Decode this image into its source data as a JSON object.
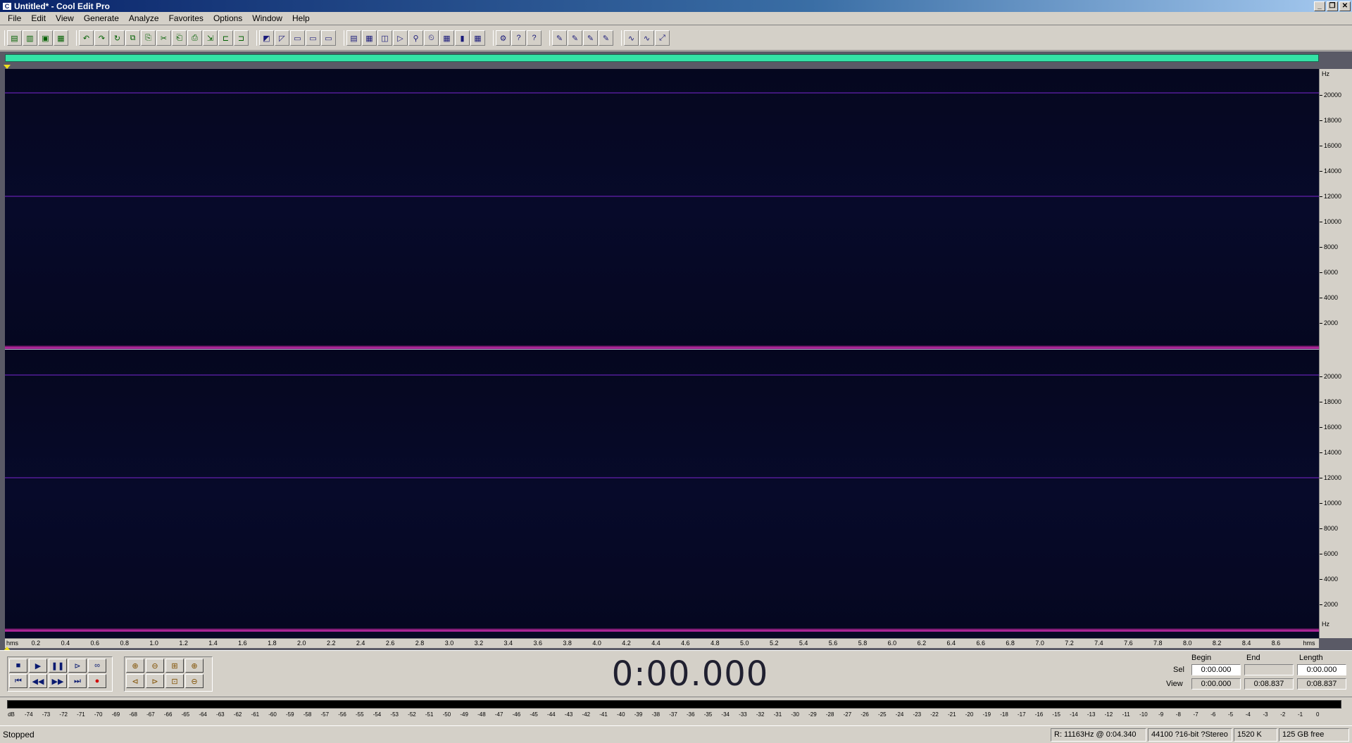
{
  "window": {
    "title": "Untitled* - Cool Edit Pro",
    "buttons": [
      "_",
      "❐",
      "✕"
    ]
  },
  "menu": [
    "File",
    "Edit",
    "View",
    "Generate",
    "Analyze",
    "Favorites",
    "Options",
    "Window",
    "Help"
  ],
  "toolbar": {
    "groups": [
      [
        "waveform-view-icon",
        "multitrack-view-icon",
        "open-icon",
        "save-icon"
      ],
      [
        "undo-icon",
        "redo-icon",
        "repeat-icon",
        "copy-icon",
        "copy-new-icon",
        "cut-icon",
        "paste-icon",
        "paste-new-icon",
        "mix-paste-icon",
        "trim-icon",
        "select-entire-icon"
      ],
      [
        "spectral-view-icon",
        "waveform-icon",
        "left-channel-icon",
        "right-channel-icon",
        "both-channels-icon"
      ],
      [
        "cue-list-icon",
        "play-list-icon",
        "info-icon",
        "preroll-icon",
        "scrub-icon",
        "time-format-icon",
        "frames-icon",
        "meter-icon",
        "grid-icon"
      ],
      [
        "settings-icon",
        "hint-icon",
        "help-icon"
      ],
      [
        "effect-1-icon",
        "effect-2-icon",
        "effect-3-icon",
        "effect-4-icon"
      ],
      [
        "analysis-icon",
        "stats-icon",
        "zoom-full-icon"
      ]
    ]
  },
  "spectrogram": {
    "hz_unit": "Hz",
    "hz_labels": [
      "20000",
      "18000",
      "16000",
      "14000",
      "12000",
      "10000",
      "8000",
      "6000",
      "4000",
      "2000"
    ],
    "time_labels": [
      "hms",
      "0.2",
      "0.4",
      "0.6",
      "0.8",
      "1.0",
      "1.2",
      "1.4",
      "1.6",
      "1.8",
      "2.0",
      "2.2",
      "2.4",
      "2.6",
      "2.8",
      "3.0",
      "3.2",
      "3.4",
      "3.6",
      "3.8",
      "4.0",
      "4.2",
      "4.4",
      "4.6",
      "4.8",
      "5.0",
      "5.2",
      "5.4",
      "5.6",
      "5.8",
      "6.0",
      "6.2",
      "6.4",
      "6.6",
      "6.8",
      "7.0",
      "7.2",
      "7.4",
      "7.6",
      "7.8",
      "8.0",
      "8.2",
      "8.4",
      "8.6",
      "hms"
    ],
    "duration_seconds": 8.837
  },
  "transport": {
    "time_display": "0:00.000",
    "row1": [
      {
        "name": "stop-icon",
        "glyph": "■"
      },
      {
        "name": "play-icon",
        "glyph": "▶"
      },
      {
        "name": "pause-icon",
        "glyph": "❚❚"
      },
      {
        "name": "play-to-end-icon",
        "glyph": "⊳"
      },
      {
        "name": "loop-icon",
        "glyph": "∞"
      }
    ],
    "row2": [
      {
        "name": "go-to-start-icon",
        "glyph": "⏮"
      },
      {
        "name": "rewind-icon",
        "glyph": "◀◀"
      },
      {
        "name": "fast-forward-icon",
        "glyph": "▶▶"
      },
      {
        "name": "go-to-end-icon",
        "glyph": "⏭"
      },
      {
        "name": "record-icon",
        "glyph": "●"
      }
    ],
    "zoom_row1": [
      {
        "name": "zoom-in-icon",
        "glyph": "⊕"
      },
      {
        "name": "zoom-out-icon",
        "glyph": "⊖"
      },
      {
        "name": "zoom-full-icon",
        "glyph": "⊞"
      },
      {
        "name": "zoom-in-vertical-icon",
        "glyph": "⊕"
      }
    ],
    "zoom_row2": [
      {
        "name": "zoom-left-icon",
        "glyph": "⊲"
      },
      {
        "name": "zoom-right-icon",
        "glyph": "⊳"
      },
      {
        "name": "zoom-selection-icon",
        "glyph": "⊡"
      },
      {
        "name": "zoom-out-vertical-icon",
        "glyph": "⊖"
      }
    ]
  },
  "selection": {
    "begin_label": "Begin",
    "end_label": "End",
    "length_label": "Length",
    "sel_label": "Sel",
    "view_label": "View",
    "sel_begin": "0:00.000",
    "sel_end": "",
    "sel_length": "0:00.000",
    "view_begin": "0:00.000",
    "view_end": "0:08.837",
    "view_length": "0:08.837"
  },
  "meter": {
    "labels": [
      "dB",
      "-74",
      "-73",
      "-72",
      "-71",
      "-70",
      "-69",
      "-68",
      "-67",
      "-66",
      "-65",
      "-64",
      "-63",
      "-62",
      "-61",
      "-60",
      "-59",
      "-58",
      "-57",
      "-56",
      "-55",
      "-54",
      "-53",
      "-52",
      "-51",
      "-50",
      "-49",
      "-48",
      "-47",
      "-46",
      "-45",
      "-44",
      "-43",
      "-42",
      "-41",
      "-40",
      "-39",
      "-38",
      "-37",
      "-36",
      "-35",
      "-34",
      "-33",
      "-32",
      "-31",
      "-30",
      "-29",
      "-28",
      "-27",
      "-26",
      "-25",
      "-24",
      "-23",
      "-22",
      "-21",
      "-20",
      "-19",
      "-18",
      "-17",
      "-16",
      "-15",
      "-14",
      "-13",
      "-12",
      "-11",
      "-10",
      "-9",
      "-8",
      "-7",
      "-6",
      "-5",
      "-4",
      "-3",
      "-2",
      "-1",
      "0"
    ]
  },
  "status": {
    "state": "Stopped",
    "readout": "R: 11163Hz @ 0:04.340",
    "format": "44100 ?16-bit ?Stereo",
    "size": "1520 K",
    "free": "125 GB free"
  },
  "colors": {
    "overview": "#34e3a6",
    "spectrogram_bg": "#060824",
    "harmonic_band": "#4a1a8a",
    "low_energy": "#c02aa0"
  }
}
